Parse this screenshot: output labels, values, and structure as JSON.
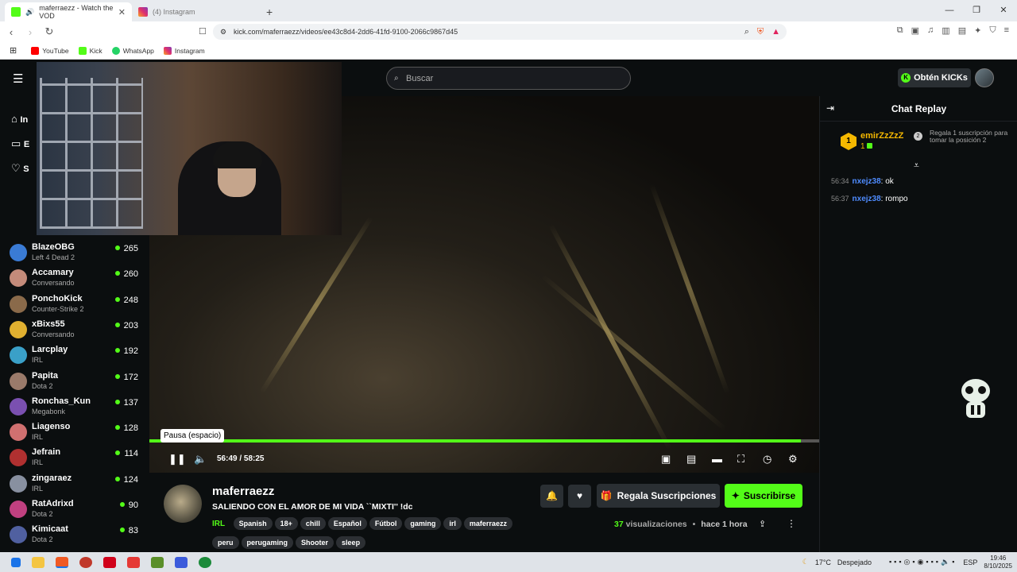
{
  "browser": {
    "tabs": [
      {
        "title": "maferraezz - Watch the VOD",
        "active": true
      },
      {
        "title": "(4) Instagram",
        "active": false
      }
    ],
    "new_tab": "+",
    "window": {
      "min": "—",
      "restore": "❐",
      "close": "✕"
    },
    "url": "kick.com/maferraezz/videos/ee43c8d4-2dd6-41fd-9100-2066c9867d45",
    "bookmarks": [
      "YouTube",
      "Kick",
      "WhatsApp",
      "Instagram"
    ]
  },
  "kick": {
    "search_placeholder": "Buscar",
    "kicks_button": "Obtén KICKs",
    "sidebar": {
      "partial_labels": [
        "In",
        "E",
        "S"
      ],
      "channels": [
        {
          "name": "BlazeOBG",
          "category": "Left 4 Dead 2",
          "viewers": "265",
          "color": "#3a7bd5"
        },
        {
          "name": "Accamary",
          "category": "Conversando",
          "viewers": "260",
          "color": "#c48b7a"
        },
        {
          "name": "PonchoKick",
          "category": "Counter-Strike 2",
          "viewers": "248",
          "color": "#8a6a4a"
        },
        {
          "name": "xBixs55",
          "category": "Conversando",
          "viewers": "203",
          "color": "#e0b030"
        },
        {
          "name": "Larcplay",
          "category": "IRL",
          "viewers": "192",
          "color": "#3aa0c8"
        },
        {
          "name": "Papita",
          "category": "Dota 2",
          "viewers": "172",
          "color": "#9a7a6a"
        },
        {
          "name": "Ronchas_Kun",
          "category": "Megabonk",
          "viewers": "137",
          "color": "#7a50b0"
        },
        {
          "name": "Liagenso",
          "category": "IRL",
          "viewers": "128",
          "color": "#d07070"
        },
        {
          "name": "Jefrain",
          "category": "IRL",
          "viewers": "114",
          "color": "#b03030"
        },
        {
          "name": "zingaraez",
          "category": "IRL",
          "viewers": "124",
          "color": "#8890a0"
        },
        {
          "name": "RatAdrixd",
          "category": "Dota 2",
          "viewers": "90",
          "color": "#c04080"
        },
        {
          "name": "Kimicaat",
          "category": "Dota 2",
          "viewers": "83",
          "color": "#5060a0"
        }
      ]
    },
    "player": {
      "tooltip": "Pausa (espacio)",
      "time_current": "56:49",
      "time_total": "58:25",
      "progress": 0.9725
    },
    "stream": {
      "streamer": "maferraezz",
      "title": "SALIENDO CON EL AMOR DE MI VIDA ``MIXTI'' !dc",
      "category": "IRL",
      "tags": [
        "Spanish",
        "18+",
        "chill",
        "Español",
        "Fútbol",
        "gaming",
        "irl",
        "maferraezz",
        "peru",
        "perugaming",
        "Shooter",
        "sleep"
      ],
      "gift_button": "Regala Suscripciones",
      "subscribe_button": "Suscribirse",
      "views_count": "37",
      "views_label": "visualizaciones",
      "separator": "•",
      "ago": "hace 1 hora"
    },
    "chat": {
      "title": "Chat Replay",
      "gifter": {
        "rank": "1",
        "name": "emirZzZzZ",
        "count": "1"
      },
      "gift_note": {
        "rank": "2",
        "text": "Regala 1 suscripción para tomar la posición 2"
      },
      "messages": [
        {
          "time": "56:34",
          "user": "nxejz38",
          "text": ": ok"
        },
        {
          "time": "56:37",
          "user": "nxejz38",
          "text": ": rompo"
        }
      ]
    }
  },
  "taskbar": {
    "weather_temp": "17°C",
    "weather_text": "Despejado",
    "lang": "ESP",
    "time": "19:46",
    "date": "8/10/2025"
  },
  "colors": {
    "accent": "#53fc18",
    "bg": "#0b0e0f",
    "gifter": "#f5b800",
    "chat_user": "#4f8cff"
  }
}
